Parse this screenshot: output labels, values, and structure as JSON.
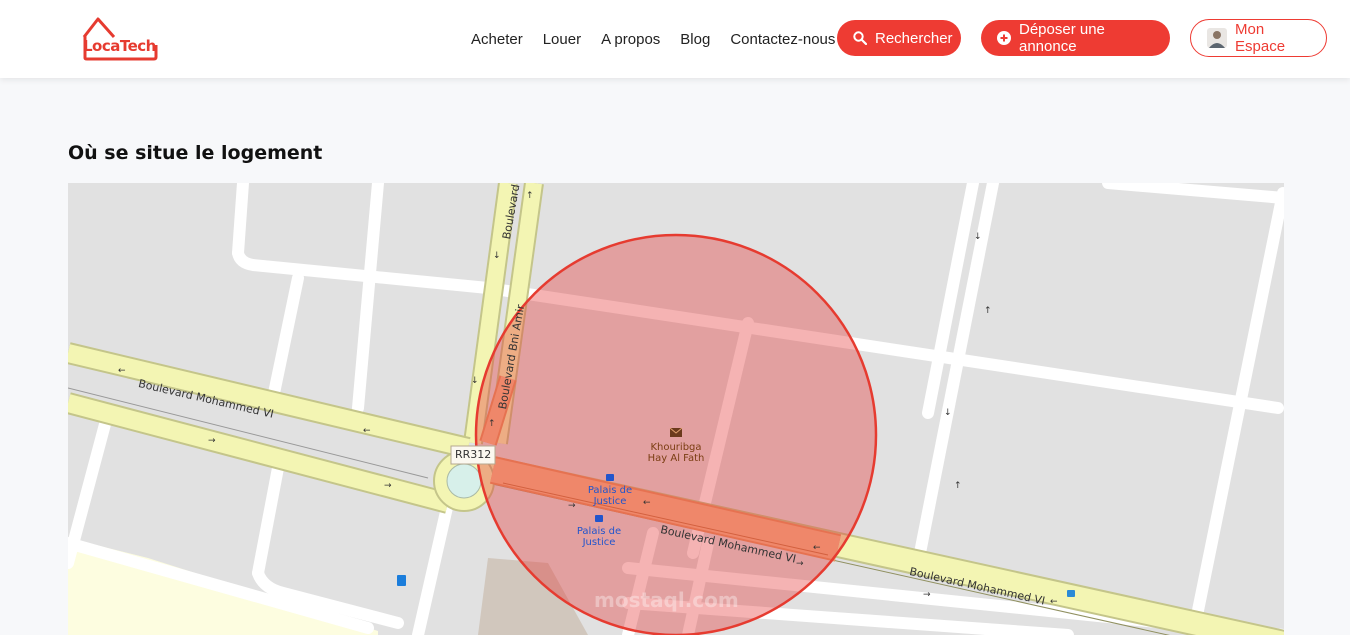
{
  "header": {
    "logo_text": "LocaTech",
    "nav": [
      "Acheter",
      "Louer",
      "A propos",
      "Blog",
      "Contactez-nous"
    ],
    "search_button": "Rechercher",
    "post_button": "Déposer une annonce",
    "account_button": "Mon Espace"
  },
  "section": {
    "title": "Où se situe le logement"
  },
  "map": {
    "roads": {
      "boulevard_mohammed_vi": "Boulevard Mohammed VI",
      "boulevard_bni_amir": "Boulevard Bni Amir",
      "route_ref": "RR312"
    },
    "pois": {
      "post_office": "Khouribga Hay Al Fath",
      "bus_stop": "Palais de Justice"
    },
    "watermark": "mostaql.com",
    "colors": {
      "accent": "#ee3b33",
      "circle_fill": "rgba(228,56,56,0.38)",
      "primary_road": "#f5f6b4",
      "highlight_road": "#f6b98a",
      "block": "#dedede"
    }
  }
}
